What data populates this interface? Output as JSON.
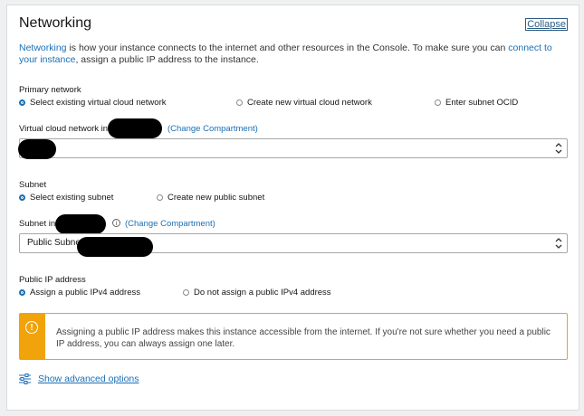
{
  "section": {
    "title": "Networking",
    "collapse_label": "Collapse"
  },
  "intro": {
    "link1": "Networking",
    "text1": " is how your instance connects to the internet and other resources in the Console. To make sure you can ",
    "link2": "connect to your instance",
    "text2": ", assign a public IP address to the instance."
  },
  "primary_network": {
    "label": "Primary network",
    "options": [
      "Select existing virtual cloud network",
      "Create new virtual cloud network",
      "Enter subnet OCID"
    ],
    "selected": 0
  },
  "vcn": {
    "label": "Virtual cloud network in",
    "change_compartment": "(Change Compartment)",
    "value": ""
  },
  "subnet": {
    "label": "Subnet",
    "options": [
      "Select existing subnet",
      "Create new public subnet"
    ],
    "selected": 0
  },
  "subnet_field": {
    "label": "Subnet in",
    "info_icon": "i",
    "change_compartment": "(Change Compartment)",
    "value": "Public Subne"
  },
  "public_ip": {
    "label": "Public IP address",
    "options": [
      "Assign a public IPv4 address",
      "Do not assign a public IPv4 address"
    ],
    "selected": 0
  },
  "warning": {
    "icon": "!",
    "text": "Assigning a public IP address makes this instance accessible from the internet. If you're not sure whether you need a public IP address, you can always assign one later."
  },
  "advanced": {
    "label": "Show advanced options",
    "icon": "sliders-icon"
  }
}
